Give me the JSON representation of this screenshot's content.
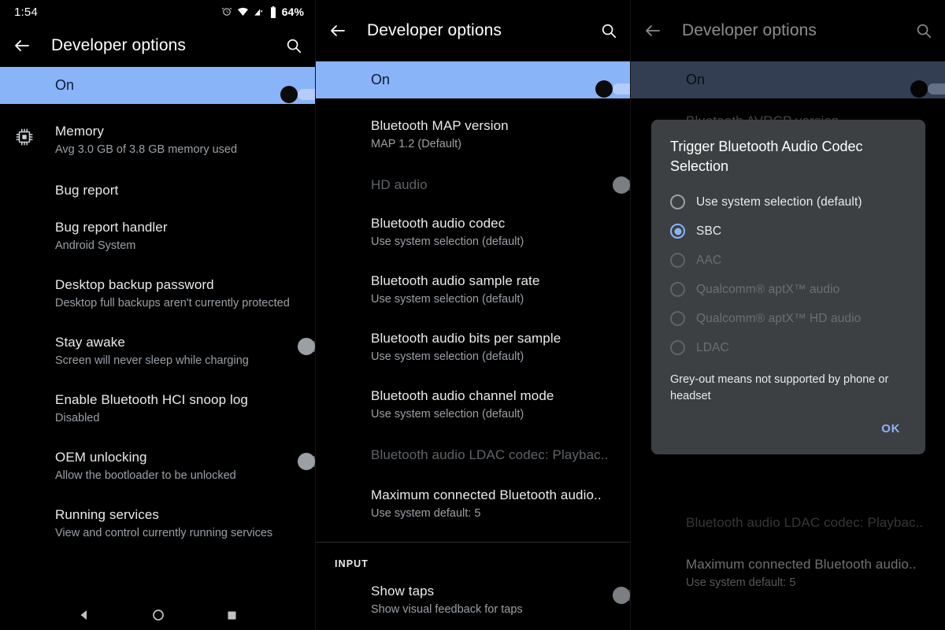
{
  "status_bar": {
    "time": "1:54",
    "battery_percent": "64%",
    "icons": [
      "alarm-icon",
      "wifi-icon",
      "cell-signal-off-icon",
      "battery-icon"
    ]
  },
  "toolbar": {
    "title": "Developer options",
    "back_icon": "arrow-back-icon",
    "search_icon": "search-icon"
  },
  "master_switch": {
    "label": "On",
    "state": "on"
  },
  "colors": {
    "accent_blue": "#8ab4f8",
    "master_band": "#8ab4f8",
    "master_band_dimmed": "#5d7296",
    "dialog_surface": "#3c4043",
    "background": "#000000",
    "title_text": "#e8eaed",
    "secondary_text": "#9aa0a6",
    "disabled_text": "#5f6368"
  },
  "panel1": {
    "rows": [
      {
        "icon": "memory-chip-icon",
        "title": "Memory",
        "sub": "Avg 3.0 GB of 3.8 GB memory used"
      },
      {
        "title": "Bug report",
        "sub": ""
      },
      {
        "title": "Bug report handler",
        "sub": "Android System"
      },
      {
        "title": "Desktop backup password",
        "sub": "Desktop full backups aren't currently protected"
      },
      {
        "title": "Stay awake",
        "sub": "Screen will never sleep while charging",
        "switch": "off"
      },
      {
        "title": "Enable Bluetooth HCI snoop log",
        "sub": "Disabled"
      },
      {
        "title": "OEM unlocking",
        "sub": "Allow the bootloader to be unlocked",
        "switch": "off"
      },
      {
        "title": "Running services",
        "sub": "View and control currently running services"
      }
    ]
  },
  "panel2": {
    "rows": [
      {
        "title": "Bluetooth MAP version",
        "sub": "MAP 1.2 (Default)"
      },
      {
        "title": "HD audio",
        "sub": "",
        "switch": "off",
        "disabled": true
      },
      {
        "title": "Bluetooth audio codec",
        "sub": "Use system selection (default)"
      },
      {
        "title": "Bluetooth audio sample rate",
        "sub": "Use system selection (default)"
      },
      {
        "title": "Bluetooth audio bits per sample",
        "sub": "Use system selection (default)"
      },
      {
        "title": "Bluetooth audio channel mode",
        "sub": "Use system selection (default)"
      },
      {
        "title": "Bluetooth audio LDAC codec: Playbac..",
        "sub": "",
        "disabled": true
      },
      {
        "title": "Maximum connected Bluetooth audio..",
        "sub": "Use system default: 5"
      }
    ],
    "section_header": "INPUT",
    "input_rows": [
      {
        "title": "Show taps",
        "sub": "Show visual feedback for taps",
        "switch": "off"
      }
    ]
  },
  "panel3": {
    "background_rows": [
      {
        "title": "Bluetooth AVRCP version",
        "sub": ""
      },
      {
        "title": "Bluetooth audio LDAC codec: Playbac..",
        "sub": "",
        "disabled": true
      },
      {
        "title": "Maximum connected Bluetooth audio..",
        "sub": "Use system default: 5"
      }
    ],
    "dialog": {
      "title": "Trigger Bluetooth Audio Codec Selection",
      "options": [
        {
          "label": "Use system selection (default)",
          "checked": false,
          "disabled": false
        },
        {
          "label": "SBC",
          "checked": true,
          "disabled": false
        },
        {
          "label": "AAC",
          "checked": false,
          "disabled": true
        },
        {
          "label": "Qualcomm® aptX™ audio",
          "checked": false,
          "disabled": true
        },
        {
          "label": "Qualcomm® aptX™ HD audio",
          "checked": false,
          "disabled": true
        },
        {
          "label": "LDAC",
          "checked": false,
          "disabled": true
        }
      ],
      "note": "Grey-out means not supported by phone or headset",
      "ok_label": "OK"
    }
  },
  "nav_bar": {
    "back_icon": "nav-back-triangle-icon",
    "home_icon": "nav-home-circle-icon",
    "recents_icon": "nav-recents-square-icon"
  }
}
